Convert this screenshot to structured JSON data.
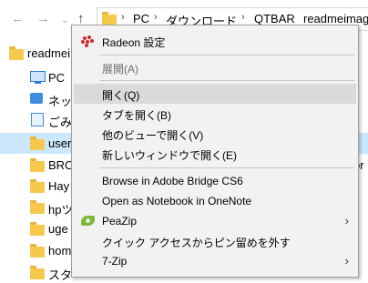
{
  "address_bar": {
    "crumbs": [
      "PC",
      "ダウンロード",
      "QTBAR",
      "readmeimag"
    ]
  },
  "tree": {
    "items": [
      {
        "label": "readmei",
        "icon": "folder-icon",
        "selected": false
      },
      {
        "label": "PC",
        "icon": "pc-icon",
        "selected": false
      },
      {
        "label": "ネット",
        "icon": "network-icon",
        "selected": false
      },
      {
        "label": "ごみ箱",
        "icon": "recycle-bin-icon",
        "selected": false
      },
      {
        "label": "user",
        "icon": "folder-icon",
        "selected": true
      },
      {
        "label": "BRO",
        "icon": "folder-icon",
        "selected": false
      },
      {
        "label": "Hay",
        "icon": "folder-icon",
        "selected": false
      },
      {
        "label": "hpツ",
        "icon": "folder-icon",
        "selected": false
      },
      {
        "label": "uge",
        "icon": "folder-icon",
        "selected": false
      },
      {
        "label": "hom",
        "icon": "folder-icon",
        "selected": false
      },
      {
        "label": "スタ",
        "icon": "folder-icon",
        "selected": false
      }
    ],
    "right_edge_text": "pr"
  },
  "context_menu": {
    "items": [
      {
        "label": "Radeon 設定",
        "icon": "radeon-icon"
      },
      {
        "label": "展開(A)",
        "disabled": true
      },
      {
        "label": "開く(Q)",
        "hover": true
      },
      {
        "label": "タブを開く(B)"
      },
      {
        "label": "他のビューで開く(V)"
      },
      {
        "label": "新しいウィンドウで開く(E)"
      },
      {
        "label": "Browse in Adobe Bridge CS6"
      },
      {
        "label": "Open as Notebook in OneNote"
      },
      {
        "label": "PeaZip",
        "icon": "peazip-icon",
        "submenu": true
      },
      {
        "label": "クイック アクセスからピン留めを外す"
      },
      {
        "label": "7-Zip",
        "submenu": true
      }
    ],
    "submenu_arrow": "›"
  }
}
